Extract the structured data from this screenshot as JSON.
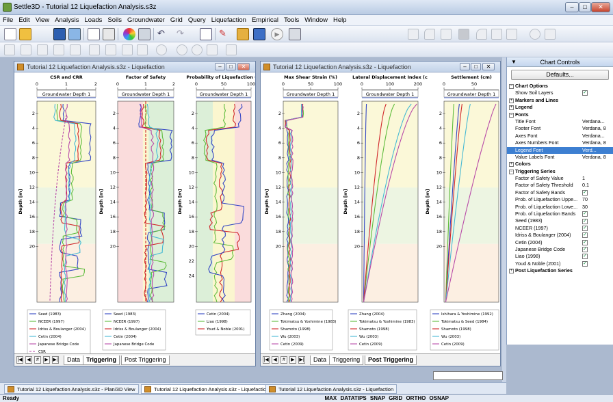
{
  "window": {
    "title": "Settle3D - Tutorial 12 Liquefaction Analysis.s3z",
    "min": "–",
    "max": "□",
    "close": "✕"
  },
  "menu": [
    "File",
    "Edit",
    "View",
    "Analysis",
    "Loads",
    "Soils",
    "Groundwater",
    "Grid",
    "Query",
    "Liquefaction",
    "Empirical",
    "Tools",
    "Window",
    "Help"
  ],
  "left_window": {
    "title": "Tutorial 12 Liquefaction Analysis.s3z - Liquefaction",
    "tabs": [
      "Data",
      "Triggering",
      "Post Triggering"
    ],
    "active_tab": "Triggering",
    "plots": [
      {
        "title": "CSR and CRR",
        "ticks": [
          "0",
          "1",
          "2"
        ],
        "gw": "Groundwater Depth 1"
      },
      {
        "title": "Factor of Safety",
        "ticks": [
          "0",
          "1",
          "2"
        ],
        "gw": "Groundwater Depth 1"
      },
      {
        "title": "Probability of Liquefaction (%",
        "ticks": [
          "0",
          "50",
          "100"
        ],
        "gw": "Groundwater Depth 1"
      }
    ],
    "depth_label": "Depth [m]",
    "depth_ticks": [
      "2",
      "4",
      "6",
      "8",
      "10",
      "12",
      "14",
      "16",
      "18",
      "20"
    ],
    "depth_ticks_extra": [
      "22",
      "24"
    ],
    "legend1": [
      "Seed (1983)",
      "NCEER (1997)",
      "Idriss & Boulanger (2004)",
      "Cetin (2004)",
      "Japanese Bridge Code",
      "CSR"
    ],
    "legend2": [
      "Seed (1983)",
      "NCEER (1997)",
      "Idriss & Boulanger (2004)",
      "Cetin (2004)",
      "Japanese Bridge Code"
    ],
    "legend3": [
      "Cetin (2004)",
      "Liao (1998)",
      "Youd & Noble (2001)"
    ]
  },
  "right_window": {
    "title": "Tutorial 12 Liquefaction Analysis.s3z - Liquefaction",
    "tabs": [
      "Data",
      "Triggering",
      "Post Triggering"
    ],
    "active_tab": "Post Triggering",
    "plots": [
      {
        "title": "Max Shear Strain (%)",
        "ticks": [
          "0",
          "50",
          "100"
        ],
        "gw": "Groundwater Depth 1"
      },
      {
        "title": "Lateral Displacement Index (c",
        "ticks": [
          "0",
          "100",
          "200"
        ],
        "gw": "Groundwater Depth 1"
      },
      {
        "title": "Settlement (cm)",
        "ticks": [
          "0",
          "50"
        ],
        "gw": "Groundwater Depth 1"
      }
    ],
    "legend1": [
      "Zhang (2004)",
      "Tokimatsu & Yoshimine (1983)",
      "Shamoto (1998)",
      "Wu (2003)",
      "Cetin (2009)"
    ],
    "legend2": [
      "Zhang (2004)",
      "Tokimatsu & Yoshimine (1983)",
      "Shamoto (1998)",
      "Wu (2003)",
      "Cetin (2009)"
    ],
    "legend3": [
      "Ishihara & Yoshimine (1992)",
      "Tokimatsu & Seed (1984)",
      "Shamoto (1998)",
      "Wu (2003)",
      "Cetin (2009)"
    ]
  },
  "chart_controls": {
    "title": "Chart Controls",
    "defaults": "Defaults...",
    "rows": [
      {
        "type": "cat",
        "label": "Chart Options",
        "exp": "−"
      },
      {
        "type": "prop",
        "label": "Show Soil Layers",
        "check": true
      },
      {
        "type": "cat",
        "label": "Markers and Lines",
        "exp": "+"
      },
      {
        "type": "cat",
        "label": "Legend",
        "exp": "+"
      },
      {
        "type": "cat",
        "label": "Fonts",
        "exp": "−"
      },
      {
        "type": "prop",
        "label": "Title Font",
        "value": "Verdana..."
      },
      {
        "type": "prop",
        "label": "Footer Font",
        "value": "Verdana, 8"
      },
      {
        "type": "prop",
        "label": "Axes Font",
        "value": "Verdana..."
      },
      {
        "type": "prop",
        "label": "Axes Numbers Font",
        "value": "Verdana, 8"
      },
      {
        "type": "prop",
        "label": "Legend Font",
        "value": "Verd...",
        "sel": true
      },
      {
        "type": "prop",
        "label": "Value Labels Font",
        "value": "Verdana, 8"
      },
      {
        "type": "cat",
        "label": "Colors",
        "exp": "+"
      },
      {
        "type": "cat",
        "label": "Triggering Series",
        "exp": "−"
      },
      {
        "type": "prop",
        "label": "Factor of Safety Value",
        "value": "1"
      },
      {
        "type": "prop",
        "label": "Factor of Safety Threshold",
        "value": "0.1"
      },
      {
        "type": "prop",
        "label": "Factor of Safety Bands",
        "check": true
      },
      {
        "type": "prop",
        "label": "Prob. of Liquefaction Uppe...",
        "value": "70"
      },
      {
        "type": "prop",
        "label": "Prob. of Liquefaction Lowe...",
        "value": "30"
      },
      {
        "type": "prop",
        "label": "Prob. of Liquefaction Bands",
        "check": true
      },
      {
        "type": "prop",
        "label": "Seed (1983)",
        "check": true
      },
      {
        "type": "prop",
        "label": "NCEER (1997)",
        "check": true
      },
      {
        "type": "prop",
        "label": "Idriss & Boulanger (2004)",
        "check": true
      },
      {
        "type": "prop",
        "label": "Cetin (2004)",
        "check": true
      },
      {
        "type": "prop",
        "label": "Japanese Bridge Code",
        "check": true
      },
      {
        "type": "prop",
        "label": "Liao (1998)",
        "check": true
      },
      {
        "type": "prop",
        "label": "Youd & Noble (2001)",
        "check": true
      },
      {
        "type": "cat",
        "label": "Post Liquefaction Series",
        "exp": "+"
      }
    ]
  },
  "taskbar": [
    "Tutorial 12 Liquefaction Analysis.s3z - Plan/3D View",
    "Tutorial 12 Liquefaction Analysis.s3z - Liquefaction",
    "Tutorial 12 Liquefaction Analysis.s3z - Liquefaction"
  ],
  "status": {
    "left": "Ready",
    "right": "MAX DATATIPS  SNAP  GRID  ORTHO  OSNAP"
  },
  "colors": {
    "blue": "#3346c4",
    "green": "#5ebc3c",
    "red": "#d0262a",
    "cyan": "#46b9d4",
    "magenta": "#b84aa8"
  }
}
